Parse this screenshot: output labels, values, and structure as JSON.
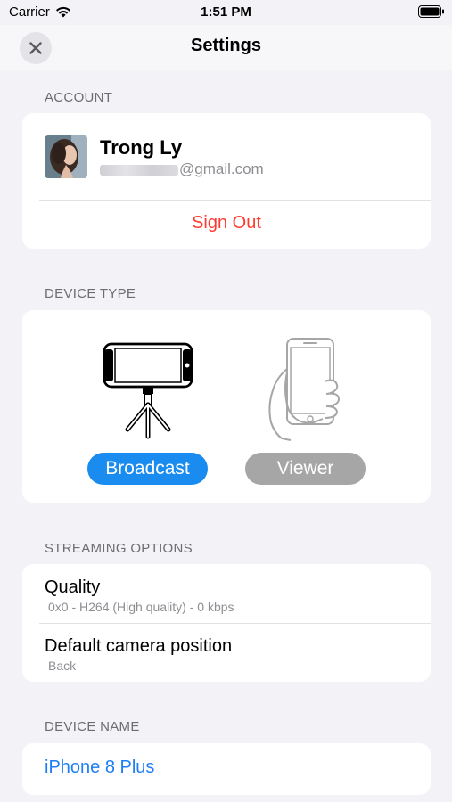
{
  "status_bar": {
    "carrier": "Carrier",
    "time": "1:51 PM"
  },
  "nav": {
    "title": "Settings",
    "close_icon": "close-icon"
  },
  "account": {
    "header": "ACCOUNT",
    "name": "Trong Ly",
    "email_domain": "@gmail.com",
    "sign_out": "Sign Out"
  },
  "device_type": {
    "header": "DEVICE TYPE",
    "options": [
      {
        "label": "Broadcast",
        "selected": true,
        "icon": "tripod-phone-icon",
        "color": "#1a8cf0"
      },
      {
        "label": "Viewer",
        "selected": false,
        "icon": "hand-phone-icon",
        "color": "#a6a6a6"
      }
    ]
  },
  "streaming": {
    "header": "STREAMING OPTIONS",
    "rows": [
      {
        "title": "Quality",
        "value": "0x0 - H264 (High quality) - 0 kbps"
      },
      {
        "title": "Default camera position",
        "value": "Back"
      }
    ]
  },
  "device_name": {
    "header": "DEVICE NAME",
    "value": "iPhone 8 Plus"
  },
  "colors": {
    "accent": "#1e7ef5",
    "destructive": "#ff3b30",
    "background": "#f2f2f7"
  }
}
